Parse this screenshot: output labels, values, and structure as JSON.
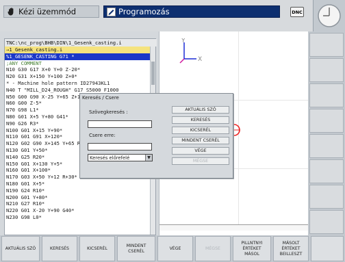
{
  "header": {
    "mode_manual": "Kézi üzemmód",
    "mode_programming": "Programozás",
    "dnc_label": "DNC"
  },
  "program": {
    "path": "TNC:\\nc_prog\\BHB\\DIN\\1_Gesenk_casting.i",
    "lines": [
      {
        "t": "→1_Gesenk_casting.i",
        "cls": "cur"
      },
      {
        "t": "%1_GESENK_CASTING G71 *",
        "cls": "sel"
      },
      {
        "t": ";ANY COMMENT",
        "cls": "cm"
      },
      {
        "t": "N10 G30 G17 X+0 Y+0 Z-20*",
        "cls": ""
      },
      {
        "t": "N20 G31 X+150 Y+100 Z+0*",
        "cls": ""
      },
      {
        "t": "* - Machine hole pattern ID27943KL1",
        "cls": ""
      },
      {
        "t": "N40 T \"MILL_D24_ROUGH\" G17 S5000 F1000",
        "cls": ""
      },
      {
        "t": "N50 G00 G90 X-25 Y+65 Z+100 M3*",
        "cls": ""
      },
      {
        "t": "N60 G00 Z-5*",
        "cls": ""
      },
      {
        "t": "N70 G98 L1*",
        "cls": ""
      },
      {
        "t": "N80 G01 X+5 Y+80 G41*",
        "cls": ""
      },
      {
        "t": "N90 G26 R3*",
        "cls": ""
      },
      {
        "t": "N100 G01 X+15 Y+90*",
        "cls": ""
      },
      {
        "t": "N110 G01 G91 X+120*",
        "cls": ""
      },
      {
        "t": "N120 G02 G90 X+145 Y+65 R+25*",
        "cls": ""
      },
      {
        "t": "N130 G01 Y+50*",
        "cls": ""
      },
      {
        "t": "N140 G25 R20*",
        "cls": ""
      },
      {
        "t": "N150 G01 X+130 Y+5*",
        "cls": ""
      },
      {
        "t": "N160 G01 X+100*",
        "cls": ""
      },
      {
        "t": "N170 G03 X+50 Y+12 R+30*",
        "cls": ""
      },
      {
        "t": "N180 G01 X+5*",
        "cls": ""
      },
      {
        "t": "N190 G24 R10*",
        "cls": ""
      },
      {
        "t": "N200 G01 Y+80*",
        "cls": ""
      },
      {
        "t": "N210 G27 R10*",
        "cls": ""
      },
      {
        "t": "N220 G01 X-20 Y+90 G40*",
        "cls": ""
      },
      {
        "t": "N230 G98 L0*",
        "cls": ""
      }
    ]
  },
  "graphics": {
    "axis_x_label": "X",
    "axis_y_label": "Y"
  },
  "dialog": {
    "title": "Keresés / Csere",
    "search_label": "Szövegkeresés :",
    "search_value": "",
    "replace_label": "Csere erre:",
    "replace_value": "",
    "direction_value": "Keresés előrefelé",
    "buttons": {
      "current_word": "AKTUÁLIS SZÓ",
      "search": "KERESÉS",
      "replace": "KICSERÉL",
      "replace_all": "MINDENT CSERÉL",
      "end": "VÉGE",
      "cancel": "MÉGSE"
    }
  },
  "softkeys": {
    "current_word": "AKTUÁLIS SZÓ",
    "search": "KERESÉS",
    "replace": "KICSERÉL",
    "replace_all": "MINDENT\nCSERÉL",
    "end": "VÉGE",
    "cancel": "MÉGSE",
    "copy_current": "PILLNTNYI\nÉRTÉKET\nMÁSOL",
    "paste_copied": "MÁSOLT\nÉRTÉKET\nBEILLESZT"
  }
}
